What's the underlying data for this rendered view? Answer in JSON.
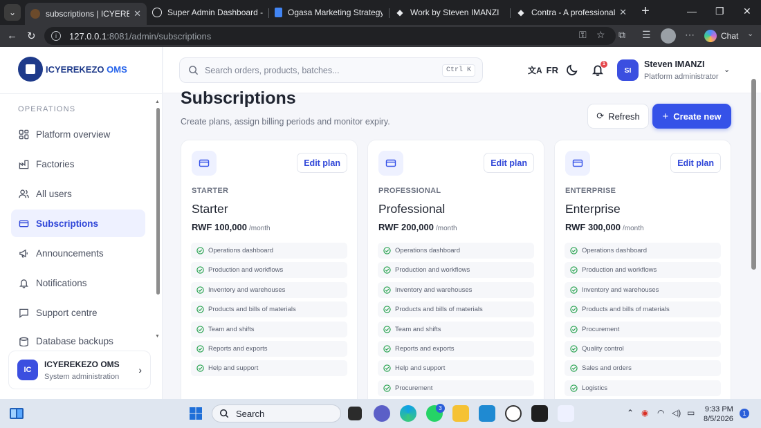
{
  "browser": {
    "tabs": [
      {
        "title": "subscriptions | ICYEREKEZO",
        "active": true
      },
      {
        "title": "Super Admin Dashboard - L",
        "active": false
      },
      {
        "title": "Ogasa Marketing Strategy P",
        "active": false
      },
      {
        "title": "Work by Steven IMANZI",
        "active": false
      },
      {
        "title": "Contra - A professional netv",
        "active": false
      }
    ],
    "url_host": "127.0.0.1",
    "url_path": ":8081/admin/subscriptions",
    "chat_label": "Chat"
  },
  "sidebar": {
    "brand_a": "ICYEREKEZO",
    "brand_b": "OMS",
    "section_label": "OPERATIONS",
    "items": [
      {
        "label": "Platform overview",
        "icon": "grid-icon",
        "active": false
      },
      {
        "label": "Factories",
        "icon": "factory-icon",
        "active": false
      },
      {
        "label": "All users",
        "icon": "users-icon",
        "active": false
      },
      {
        "label": "Subscriptions",
        "icon": "credit-card-icon",
        "active": true
      },
      {
        "label": "Announcements",
        "icon": "megaphone-icon",
        "active": false
      },
      {
        "label": "Notifications",
        "icon": "bell-icon",
        "active": false
      },
      {
        "label": "Support centre",
        "icon": "chat-icon",
        "active": false
      },
      {
        "label": "Database backups",
        "icon": "database-icon",
        "active": false
      }
    ],
    "org": {
      "initials": "IC",
      "name": "ICYEREKEZO OMS",
      "subtitle": "System administration"
    }
  },
  "header": {
    "search_placeholder": "Search orders, products, batches...",
    "shortcut": "Ctrl K",
    "language": "FR",
    "notification_count": "1",
    "user": {
      "initials": "SI",
      "name": "Steven IMANZI",
      "role": "Platform administrator"
    }
  },
  "main": {
    "title": "Subscriptions",
    "subtitle": "Create plans, assign billing periods and monitor expiry.",
    "refresh_label": "Refresh",
    "create_label": "Create new",
    "edit_label": "Edit plan",
    "plans": [
      {
        "tier": "STARTER",
        "name": "Starter",
        "price": "RWF 100,000",
        "period": "/month",
        "features": [
          "Operations dashboard",
          "Production and workflows",
          "Inventory and warehouses",
          "Products and bills of materials",
          "Team and shifts",
          "Reports and exports",
          "Help and support"
        ]
      },
      {
        "tier": "PROFESSIONAL",
        "name": "Professional",
        "price": "RWF 200,000",
        "period": "/month",
        "features": [
          "Operations dashboard",
          "Production and workflows",
          "Inventory and warehouses",
          "Products and bills of materials",
          "Team and shifts",
          "Reports and exports",
          "Help and support",
          "Procurement"
        ]
      },
      {
        "tier": "ENTERPRISE",
        "name": "Enterprise",
        "price": "RWF 300,000",
        "period": "/month",
        "features": [
          "Operations dashboard",
          "Production and workflows",
          "Inventory and warehouses",
          "Products and bills of materials",
          "Procurement",
          "Quality control",
          "Sales and orders",
          "Logistics"
        ]
      }
    ]
  },
  "taskbar": {
    "search_label": "Search",
    "whatsapp_badge": "3",
    "time": "9:33 PM",
    "date": "8/5/2026",
    "notifications": "1"
  },
  "colors": {
    "accent": "#3552e8",
    "active_bg": "#eef1ff",
    "success": "#22a04b"
  }
}
